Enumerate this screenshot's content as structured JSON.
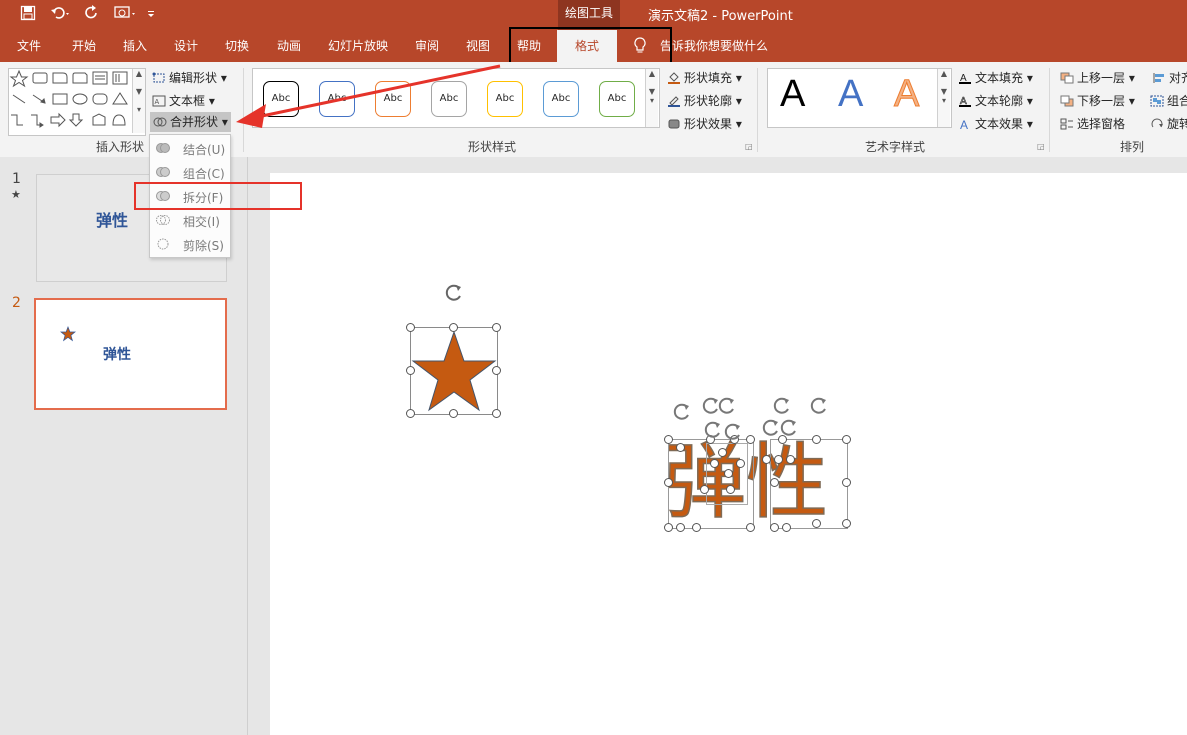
{
  "titlebar": {
    "drawing_tools": "绘图工具",
    "doc_title": "演示文稿2  -  PowerPoint"
  },
  "tabs": [
    "文件",
    "开始",
    "插入",
    "设计",
    "切换",
    "动画",
    "幻灯片放映",
    "审阅",
    "视图",
    "帮助"
  ],
  "active_tab": "格式",
  "tell_me": "告诉我你想要做什么",
  "ribbon": {
    "insert_shapes": {
      "label": "插入形状",
      "edit_shape": "编辑形状",
      "text_box": "文本框",
      "merge_shapes": "合并形状"
    },
    "shape_styles": {
      "label": "形状样式",
      "style_sample": "Abc",
      "style_colors": [
        "#000000",
        "#4472c4",
        "#ed7d31",
        "#a5a5a5",
        "#ffc000",
        "#5b9bd5",
        "#70ad47"
      ],
      "fill": "形状填充",
      "outline": "形状轮廓",
      "effects": "形状效果"
    },
    "wordart": {
      "label": "艺术字样式",
      "sample": "A",
      "text_fill": "文本填充",
      "text_outline": "文本轮廓",
      "text_effects": "文本效果"
    },
    "arrange": {
      "label": "排列",
      "bring_forward": "上移一层",
      "send_backward": "下移一层",
      "selection_pane": "选择窗格",
      "align": "对齐",
      "group": "组合",
      "rotate": "旋转"
    }
  },
  "merge_menu": [
    {
      "label": "结合(U)"
    },
    {
      "label": "组合(C)"
    },
    {
      "label": "拆分(F)"
    },
    {
      "label": "相交(I)"
    },
    {
      "label": "剪除(S)"
    }
  ],
  "slides": [
    {
      "number": "1",
      "star": "★",
      "text": "弹性"
    },
    {
      "number": "2",
      "text": "弹性"
    }
  ],
  "canvas": {
    "text": "弹性",
    "shape_color": "#c55a11"
  },
  "colors": {
    "accent": "#b7472a",
    "highlight_box": "#e5332a"
  }
}
